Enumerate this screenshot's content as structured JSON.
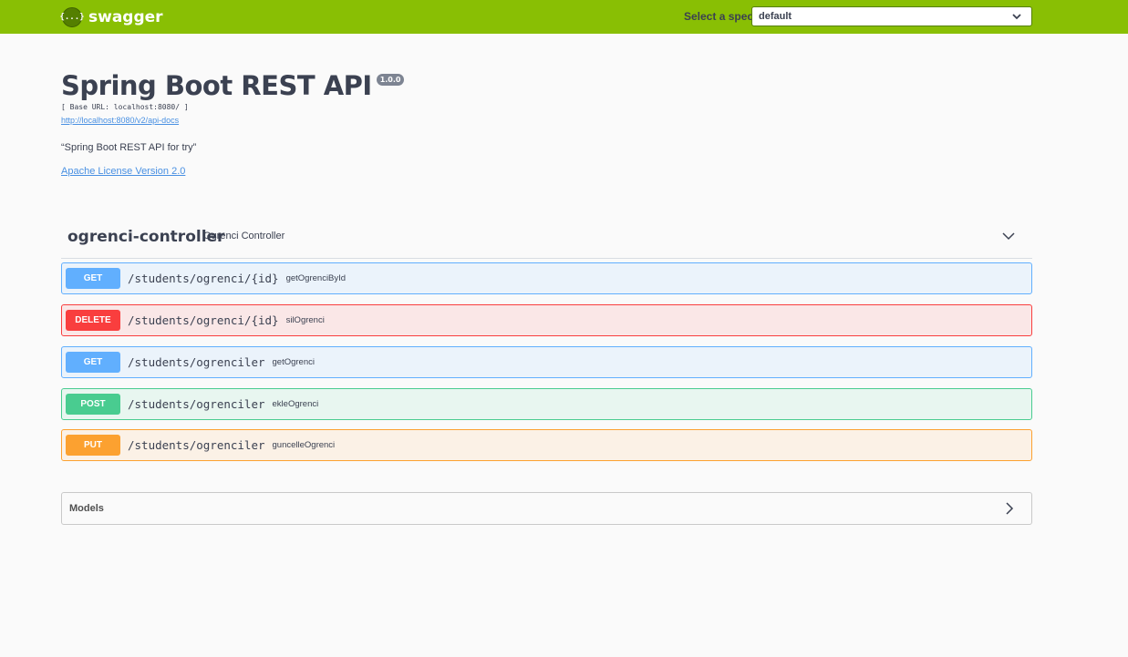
{
  "topbar": {
    "logo_glyph": "{...}",
    "logo_text": "swagger",
    "spec_label": "Select a spec",
    "spec_selected": "default",
    "bg_color": "#89bf04"
  },
  "info": {
    "title": "Spring Boot REST API",
    "version": "1.0.0",
    "base_url": "[ Base URL: localhost:8080/ ]",
    "api_docs_link": "http://localhost:8080/v2/api-docs",
    "description": "“Spring Boot REST API for try”",
    "license": "Apache License Version 2.0"
  },
  "tag": {
    "name": "ogrenci-controller",
    "description": "Ogrenci Controller",
    "chevron_icon": "chevron-down-icon"
  },
  "operations": [
    {
      "method": "GET",
      "path": "/students/ogrenci/{id}",
      "summary": "getOgrenciById"
    },
    {
      "method": "DELETE",
      "path": "/students/ogrenci/{id}",
      "summary": "silOgrenci"
    },
    {
      "method": "GET",
      "path": "/students/ogrenciler",
      "summary": "getOgrenci"
    },
    {
      "method": "POST",
      "path": "/students/ogrenciler",
      "summary": "ekleOgrenci"
    },
    {
      "method": "PUT",
      "path": "/students/ogrenciler",
      "summary": "guncelleOgrenci"
    }
  ],
  "models": {
    "title": "Models",
    "chevron_icon": "chevron-right-icon"
  },
  "colors": {
    "get": "#61affe",
    "delete": "#f93e3e",
    "post": "#49cc90",
    "put": "#fca130",
    "link": "#4990e2"
  }
}
